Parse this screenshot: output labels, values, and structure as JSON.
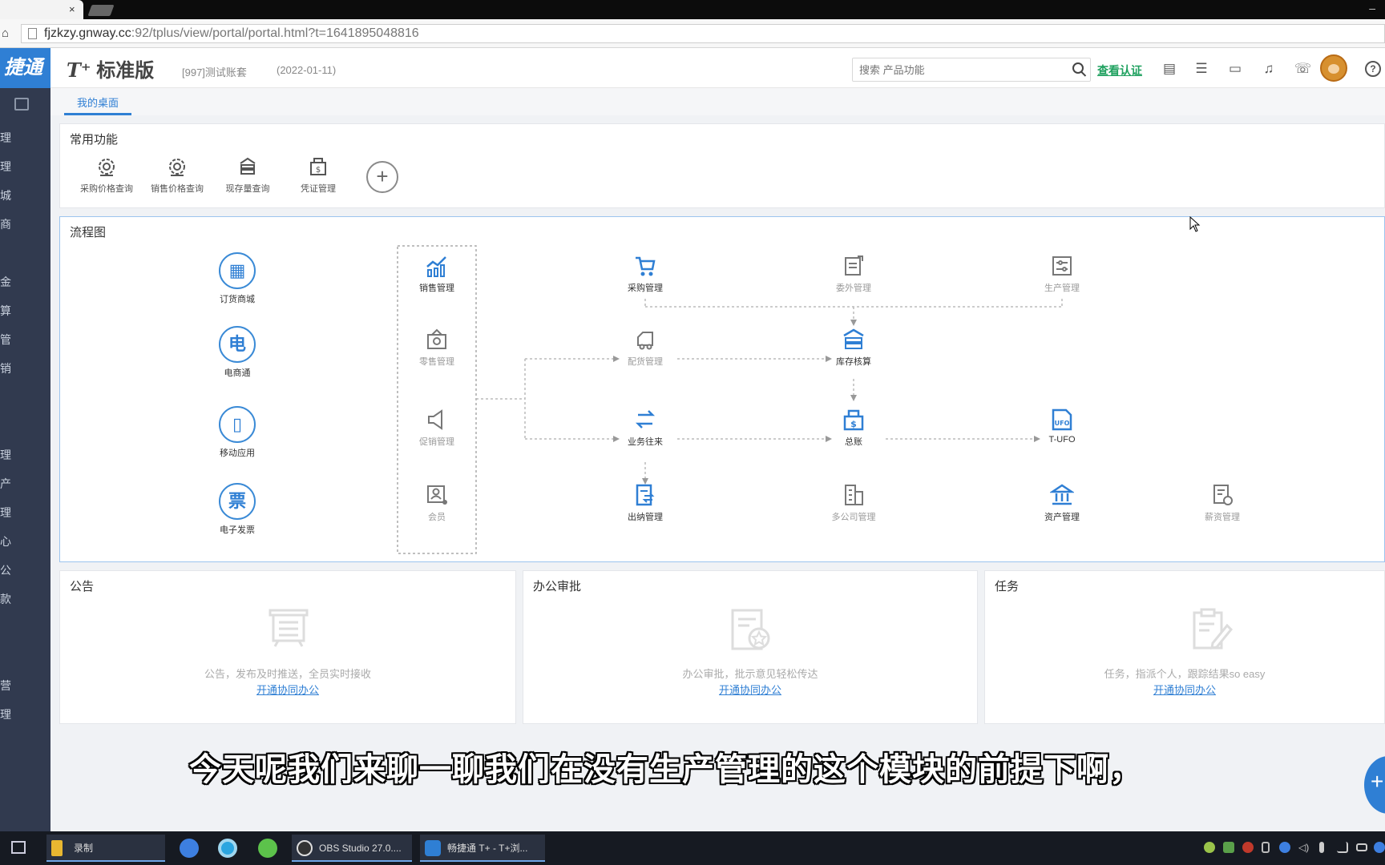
{
  "browser": {
    "tab_close": "×",
    "home_icon": "home-icon",
    "url_main": "fjzkzy.gnway.cc",
    "url_rest": ":92/tplus/view/portal/portal.html?t=1641895048816",
    "minimize": "–"
  },
  "sidebar": {
    "logo": "捷通",
    "items": [
      "理",
      "理",
      "城",
      "商",
      "",
      "金",
      "算",
      "管",
      "销",
      "",
      "",
      "理",
      "产",
      "理",
      "心",
      "公",
      "款",
      "",
      "",
      "营",
      "理"
    ]
  },
  "header": {
    "brand_t": "T⁺",
    "brand_name": "标准版",
    "account": "[997]测试账套",
    "date": "(2022-01-11)",
    "search_placeholder": "搜索 产品功能",
    "cert_link": "查看认证",
    "icons": [
      "calculator-icon",
      "checklist-icon",
      "monitor-icon",
      "bell-icon",
      "phone-icon"
    ],
    "help": "?"
  },
  "tabs": {
    "desk": "我的桌面"
  },
  "common": {
    "title": "常用功能",
    "items": [
      {
        "label": "采购价格查询",
        "icon": "gear-price-icon"
      },
      {
        "label": "销售价格查询",
        "icon": "gear-price-icon"
      },
      {
        "label": "现存量查询",
        "icon": "stock-icon"
      },
      {
        "label": "凭证管理",
        "icon": "voucher-icon"
      }
    ],
    "add": "+"
  },
  "flow": {
    "title": "流程图",
    "left": [
      {
        "label": "订货商城",
        "glyph": "▦"
      },
      {
        "label": "电商通",
        "glyph": "电"
      },
      {
        "label": "移动应用",
        "glyph": "▯"
      },
      {
        "label": "电子发票",
        "glyph": "票"
      }
    ],
    "mid": [
      {
        "label": "销售管理",
        "active": true
      },
      {
        "label": "零售管理",
        "active": false
      },
      {
        "label": "促销管理",
        "active": false
      },
      {
        "label": "会员",
        "active": false
      }
    ],
    "grid": [
      {
        "label": "采购管理",
        "active": true
      },
      {
        "label": "委外管理",
        "active": false
      },
      {
        "label": "生产管理",
        "active": false
      },
      {
        "label": "配货管理",
        "active": false
      },
      {
        "label": "库存核算",
        "active": true
      },
      {
        "label": "业务往来",
        "active": true
      },
      {
        "label": "总账",
        "active": true
      },
      {
        "label": "T-UFO",
        "active": true
      },
      {
        "label": "出纳管理",
        "active": true
      },
      {
        "label": "多公司管理",
        "active": false
      },
      {
        "label": "资产管理",
        "active": true
      },
      {
        "label": "薪资管理",
        "active": false
      }
    ]
  },
  "bottom": [
    {
      "title": "公告",
      "desc": "公告，发布及时推送，全员实时接收",
      "link": "开通协同办公"
    },
    {
      "title": "办公审批",
      "desc": "办公审批，批示意见轻松传达",
      "link": "开通协同办公"
    },
    {
      "title": "任务",
      "desc": "任务，指派个人，跟踪结果so easy",
      "link": "开通协同办公"
    }
  ],
  "subtitle": "今天呢我们来聊一聊我们在没有生产管理的这个模块的前提下啊，",
  "taskbar": {
    "items": [
      {
        "label": "录制"
      },
      {
        "label": "OBS Studio 27.0...."
      },
      {
        "label": "畅捷通 T+ - T+浏..."
      }
    ]
  },
  "colors": {
    "accent": "#2f7fd4",
    "sidebar": "#313a4f",
    "cert": "#1fa15f"
  }
}
